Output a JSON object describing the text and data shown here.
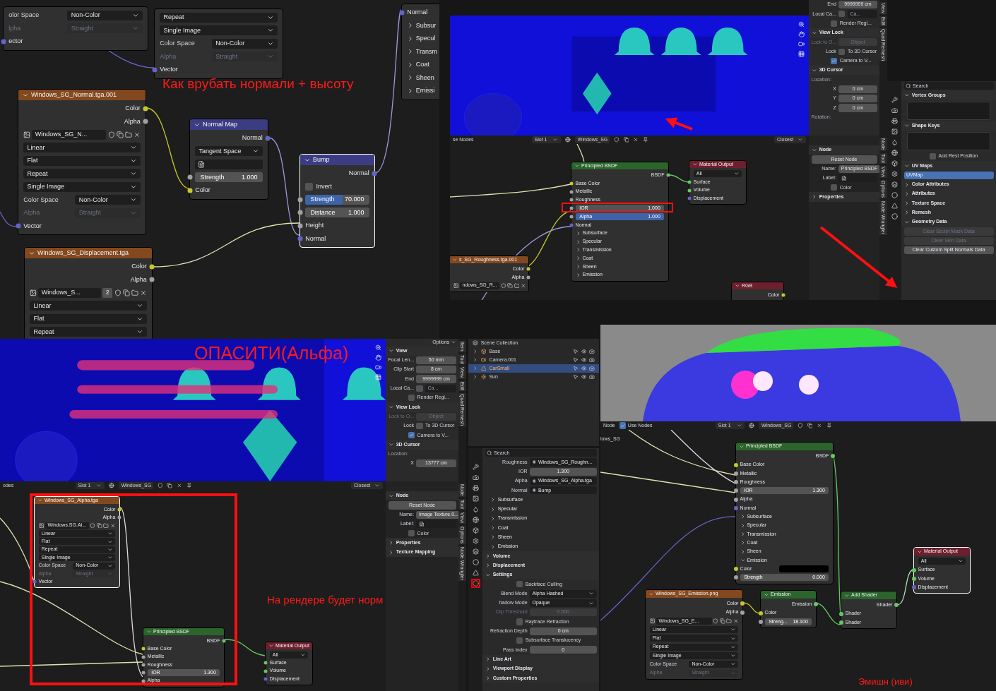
{
  "top_left": {
    "annotation": "Как врубать нормали + высоту",
    "nodes": [
      {
        "selected": false,
        "rows": [
          {
            "kind": "dropdown",
            "label": "olor Space",
            "value": "Non-Color",
            "disabled": false
          },
          {
            "kind": "dropdown",
            "label": "lpha",
            "value": "Straight",
            "disabled": true
          },
          {
            "kind": "input",
            "label": "ector",
            "color": "#6363c7"
          }
        ]
      },
      {
        "selected": false,
        "rows": [
          {
            "kind": "dropdown",
            "value": "Repeat",
            "disabled": false
          },
          {
            "kind": "dropdown",
            "value": "Single Image",
            "disabled": false
          },
          {
            "kind": "dropdown",
            "label": "Color Space",
            "value": "Non-Color",
            "disabled": false
          },
          {
            "kind": "dropdown",
            "label": "Alpha",
            "value": "Straight",
            "disabled": true
          },
          {
            "kind": "input",
            "label": "Vector",
            "color": "#6363c7"
          }
        ]
      },
      {
        "kind": "texture",
        "title": "Windows_SG_Normal.tga.001",
        "selected": false,
        "rows": [
          {
            "kind": "output",
            "label": "Color",
            "color": "#c7c729"
          },
          {
            "kind": "output",
            "label": "Alpha",
            "color": "#a1a1a1"
          },
          {
            "kind": "image",
            "value": "Windows_SG_N..."
          },
          {
            "kind": "dropdown",
            "value": "Linear",
            "disabled": false
          },
          {
            "kind": "dropdown",
            "value": "Flat",
            "disabled": false
          },
          {
            "kind": "dropdown",
            "value": "Repeat",
            "disabled": false
          },
          {
            "kind": "dropdown",
            "value": "Single Image",
            "disabled": false
          },
          {
            "kind": "dropdown",
            "label": "Color Space",
            "value": "Non-Color",
            "disabled": false
          },
          {
            "kind": "dropdown",
            "label": "Alpha",
            "value": "Straight",
            "disabled": true
          },
          {
            "kind": "input",
            "label": "Vector",
            "color": "#6363c7"
          }
        ]
      },
      {
        "kind": "vector",
        "title": "Normal Map",
        "selected": false,
        "rows": [
          {
            "kind": "output",
            "label": "Normal",
            "color": "#6363c7"
          },
          {
            "kind": "dropdown",
            "value": "Tangent Space",
            "disabled": false
          },
          {
            "kind": "uv"
          },
          {
            "kind": "field",
            "label": "Strength",
            "value": "1.000",
            "color": "#a1a1a1"
          },
          {
            "kind": "input",
            "label": "Color",
            "color": "#c7c729"
          }
        ]
      },
      {
        "kind": "vector",
        "title": "Bump",
        "selected": true,
        "rows": [
          {
            "kind": "output",
            "label": "Normal",
            "color": "#6363c7"
          },
          {
            "kind": "check",
            "label": "Invert",
            "checked": false
          },
          {
            "kind": "field",
            "label": "Strength",
            "value": "70.000",
            "level": 0.58,
            "color": "#a1a1a1"
          },
          {
            "kind": "field",
            "label": "Distance",
            "value": "1.000",
            "color": "#a1a1a1"
          },
          {
            "kind": "input",
            "label": "Height",
            "color": "#a1a1a1"
          },
          {
            "kind": "input",
            "label": "Normal",
            "color": "#6363c7"
          }
        ]
      },
      {
        "kind": "texture",
        "title": "Windows_SG_Displacement.tga",
        "selected": false,
        "rows": [
          {
            "kind": "output",
            "label": "Color",
            "color": "#c7c729"
          },
          {
            "kind": "output",
            "label": "Alpha",
            "color": "#a1a1a1"
          },
          {
            "kind": "image",
            "value": "Windows_S...",
            "users": "2"
          },
          {
            "kind": "dropdown",
            "value": "Linear",
            "disabled": false
          },
          {
            "kind": "dropdown",
            "value": "Flat",
            "disabled": false
          },
          {
            "kind": "dropdown",
            "value": "Repeat",
            "disabled": false
          }
        ]
      },
      {
        "selected": false,
        "rows": [
          {
            "kind": "input",
            "label": "Normal",
            "color": "#6363c7"
          },
          {
            "kind": "expander",
            "label": "Subsur",
            "expanded": false
          },
          {
            "kind": "expander",
            "label": "Specul",
            "expanded": false
          },
          {
            "kind": "expander",
            "label": "Transm",
            "expanded": false
          },
          {
            "kind": "expander",
            "label": "Coat",
            "expanded": false
          },
          {
            "kind": "expander",
            "label": "Sheen",
            "expanded": false
          },
          {
            "kind": "expander",
            "label": "Emissi",
            "expanded": false
          }
        ]
      }
    ]
  },
  "top_right": {
    "sidebar": {
      "tabs": [
        "View",
        "Edit",
        "Quad Remesh"
      ],
      "rows": [
        {
          "kind": "prop",
          "label": "End",
          "value": "9999999 cm"
        },
        {
          "kind": "check",
          "label": "Local Ca...",
          "checked": false,
          "value": "Ca..."
        },
        {
          "kind": "check",
          "checked": false,
          "text": "Render Regi..."
        },
        {
          "kind": "header",
          "label": "View Lock",
          "expanded": true
        },
        {
          "kind": "greyed_prop",
          "label": "Lock to O...",
          "value": "Object"
        },
        {
          "kind": "check",
          "label": "Lock",
          "checked": false,
          "text": "To 3D Cursor"
        },
        {
          "kind": "check",
          "checked": true,
          "text": "Camera to V..."
        },
        {
          "kind": "header",
          "label": "3D Cursor",
          "expanded": true
        },
        {
          "kind": "text",
          "label": "Location:"
        },
        {
          "kind": "prop",
          "label": "X",
          "value": "0 cm"
        },
        {
          "kind": "prop",
          "label": "Y",
          "value": "0 cm"
        },
        {
          "kind": "prop",
          "label": "Z",
          "value": "0 cm"
        },
        {
          "kind": "text",
          "label": "Rotation:"
        }
      ]
    },
    "node_header": {
      "editor": "se Nodes",
      "slot": "Slot 1",
      "material": "Windows_SG",
      "interp": "Closest"
    },
    "nodes": [
      {
        "kind": "shader",
        "title": "Principled BSDF",
        "selected": false,
        "rows": [
          {
            "kind": "output",
            "label": "BSDF",
            "color": "#63c763"
          },
          {
            "kind": "input",
            "label": "Base Color",
            "color": "#c7c729"
          },
          {
            "kind": "input",
            "label": "Metallic",
            "color": "#a1a1a1"
          },
          {
            "kind": "input",
            "label": "Roughness",
            "color": "#a1a1a1"
          },
          {
            "kind": "field",
            "label": "IOR",
            "value": "1.000",
            "color": "#a1a1a1"
          },
          {
            "kind": "field",
            "label": "Alpha",
            "value": "1.000",
            "level": 1,
            "color": "#a1a1a1"
          },
          {
            "kind": "input",
            "label": "Normal",
            "color": "#6363c7"
          },
          {
            "kind": "expander",
            "label": "Subsurface",
            "expanded": false
          },
          {
            "kind": "expander",
            "label": "Specular",
            "expanded": false
          },
          {
            "kind": "expander",
            "label": "Transmission",
            "expanded": false
          },
          {
            "kind": "expander",
            "label": "Coat",
            "expanded": false
          },
          {
            "kind": "expander",
            "label": "Sheen",
            "expanded": false
          },
          {
            "kind": "expander",
            "label": "Emission",
            "expanded": false
          }
        ]
      },
      {
        "kind": "output",
        "title": "Material Output",
        "selected": false,
        "rows": [
          {
            "kind": "dropdown",
            "value": "All",
            "disabled": false
          },
          {
            "kind": "input",
            "label": "Surface",
            "color": "#63c763"
          },
          {
            "kind": "input",
            "label": "Volume",
            "color": "#63c763"
          },
          {
            "kind": "input",
            "label": "Displacement",
            "color": "#6363c7"
          }
        ]
      },
      {
        "kind": "texture",
        "title": "s_SG_Roughness.tga.001",
        "selected": false,
        "rows": [
          {
            "kind": "output",
            "label": "Color",
            "color": "#c7c729"
          },
          {
            "kind": "output",
            "label": "Alpha",
            "color": "#a1a1a1"
          },
          {
            "kind": "image",
            "value": "ndows_SG_R..."
          }
        ]
      },
      {
        "kind": "output",
        "title": "RGB",
        "selected": false,
        "rows": [
          {
            "kind": "output",
            "label": "Color",
            "color": "#c7c729"
          }
        ]
      }
    ],
    "node_sidebar": {
      "tabs": [
        "Node",
        "Tool",
        "View",
        "Options",
        "Node Wrangler"
      ],
      "rows": [
        {
          "kind": "header",
          "label": "Node",
          "expanded": true
        },
        {
          "kind": "button",
          "label": "Reset Node"
        },
        {
          "kind": "prop",
          "label": "Name:",
          "value": "Principled BSDF"
        },
        {
          "kind": "prop",
          "label": "Label:"
        },
        {
          "kind": "check",
          "checked": false,
          "text": "Color"
        },
        {
          "kind": "header",
          "label": "Properties",
          "expanded": false
        }
      ]
    },
    "properties": {
      "rows": [
        {
          "kind": "search",
          "placeholder": "Search"
        },
        {
          "kind": "header",
          "label": "Vertex Groups",
          "expanded": true
        },
        {
          "kind": "listbox"
        },
        {
          "kind": "header",
          "label": "Shape Keys",
          "expanded": true
        },
        {
          "kind": "listbox"
        },
        {
          "kind": "check",
          "checked": false,
          "text": "Add Rest Position"
        },
        {
          "kind": "header",
          "label": "UV Maps",
          "expanded": true
        },
        {
          "kind": "listitem",
          "label": "UVMap",
          "selected": true
        },
        {
          "kind": "header",
          "label": "Color Attributes",
          "expanded": false
        },
        {
          "kind": "header",
          "label": "Attributes",
          "expanded": false
        },
        {
          "kind": "header",
          "label": "Texture Space",
          "expanded": false
        },
        {
          "kind": "header",
          "label": "Remesh",
          "expanded": false
        },
        {
          "kind": "header",
          "label": "Geometry Data",
          "expanded": true
        },
        {
          "kind": "greyed_button",
          "label": "Clear Sculpt Mask Data"
        },
        {
          "kind": "greyed_button",
          "label": "Clear Skin Data"
        },
        {
          "kind": "button",
          "label": "Clear Custom Split Normals Data"
        }
      ]
    }
  },
  "bottom_left": {
    "annotation": "ОПАСИТИ(Альфа)",
    "sidebar": {
      "options": "Options",
      "tabs": [
        "Item",
        "Tool",
        "View",
        "Edit",
        "Quad Remesh"
      ],
      "rows": [
        {
          "kind": "header",
          "label": "View",
          "expanded": true
        },
        {
          "kind": "prop",
          "label": "Focal Len...",
          "value": "50 mm"
        },
        {
          "kind": "prop",
          "label": "Clip Start",
          "value": "8 cm"
        },
        {
          "kind": "prop",
          "label": "End",
          "value": "9999999 cm"
        },
        {
          "kind": "check",
          "label": "Local Ca...",
          "checked": false,
          "value": "Ca..."
        },
        {
          "kind": "check",
          "checked": false,
          "text": "Render Regi..."
        },
        {
          "kind": "header",
          "label": "View Lock",
          "expanded": true
        },
        {
          "kind": "greyed_prop",
          "label": "Lock to O...",
          "value": "Object"
        },
        {
          "kind": "check",
          "label": "Lock",
          "checked": false,
          "text": "To 3D Cursor"
        },
        {
          "kind": "check",
          "checked": true,
          "text": "Camera to V..."
        },
        {
          "kind": "header",
          "label": "3D Cursor",
          "expanded": true
        },
        {
          "kind": "text",
          "label": "Location:"
        },
        {
          "kind": "prop",
          "label": "X",
          "value": "13777 cm"
        }
      ]
    },
    "node_header": {
      "editor": "odes",
      "slot": "Slot 1",
      "material": "Windows_SG",
      "interp": "Closest"
    },
    "nodes": [
      {
        "kind": "texture",
        "title": "Windows_SG_Alpha.tga",
        "selected": true,
        "rows": [
          {
            "kind": "output",
            "label": "Color",
            "color": "#c7c729"
          },
          {
            "kind": "output",
            "label": "Alpha",
            "color": "#a1a1a1"
          },
          {
            "kind": "image",
            "value": "Windows.SG.Al..."
          },
          {
            "kind": "dropdown",
            "value": "Linear",
            "disabled": false
          },
          {
            "kind": "dropdown",
            "value": "Flat",
            "disabled": false
          },
          {
            "kind": "dropdown",
            "value": "Repeat",
            "disabled": false
          },
          {
            "kind": "dropdown",
            "value": "Single Image",
            "disabled": false
          },
          {
            "kind": "dropdown",
            "label": "Color Space",
            "value": "Non-Color",
            "disabled": false
          },
          {
            "kind": "dropdown",
            "label": "Alpha",
            "value": "Straight",
            "disabled": true
          },
          {
            "kind": "input",
            "label": "Vector",
            "color": "#6363c7"
          }
        ]
      },
      {
        "kind": "shader",
        "title": "Principled BSDF",
        "selected": false,
        "rows": [
          {
            "kind": "output",
            "label": "BSDF",
            "color": "#63c763"
          },
          {
            "kind": "input",
            "label": "Base Color",
            "color": "#c7c729"
          },
          {
            "kind": "input",
            "label": "Metallic",
            "color": "#a1a1a1"
          },
          {
            "kind": "input",
            "label": "Roughness",
            "color": "#a1a1a1"
          },
          {
            "kind": "field",
            "label": "IOR",
            "value": "1.300",
            "color": "#a1a1a1"
          },
          {
            "kind": "input",
            "label": "Alpha",
            "color": "#a1a1a1"
          }
        ]
      },
      {
        "kind": "output",
        "title": "Material Output",
        "selected": false,
        "rows": [
          {
            "kind": "dropdown",
            "value": "All",
            "disabled": false
          },
          {
            "kind": "input",
            "label": "Surface",
            "color": "#63c763"
          },
          {
            "kind": "input",
            "label": "Volume",
            "color": "#63c763"
          },
          {
            "kind": "input",
            "label": "Displacement",
            "color": "#6363c7"
          }
        ]
      }
    ],
    "node_annotation": "На рендере будет норм",
    "node_sidebar": {
      "tabs": [
        "Node",
        "Tool",
        "View",
        "Options",
        "Node Wrangler"
      ],
      "rows": [
        {
          "kind": "header",
          "label": "Node",
          "expanded": true
        },
        {
          "kind": "button",
          "label": "Reset Node"
        },
        {
          "kind": "prop",
          "label": "Name:",
          "value": "Image Texture.0..."
        },
        {
          "kind": "prop",
          "label": "Label:"
        },
        {
          "kind": "check",
          "checked": false,
          "text": "Color"
        },
        {
          "kind": "header",
          "label": "Properties",
          "expanded": false
        },
        {
          "kind": "header",
          "label": "Texture Mapping",
          "expanded": false
        }
      ]
    }
  },
  "outliner": {
    "title": "Scene Collection",
    "items": [
      {
        "kind": "collection",
        "label": "Base",
        "selected": false
      },
      {
        "kind": "camera",
        "label": "Camera.001",
        "selected": false
      },
      {
        "kind": "mesh",
        "label": "CarSmall",
        "selected": true
      },
      {
        "kind": "light",
        "label": "Sun",
        "selected": false
      }
    ]
  },
  "material_properties": {
    "rows": [
      {
        "kind": "search",
        "placeholder": "Search"
      },
      {
        "kind": "link",
        "label": "Roughness",
        "value": "Windows_SG_Roughn..."
      },
      {
        "kind": "prop",
        "label": "IOR",
        "value": "1.300"
      },
      {
        "kind": "link",
        "label": "Alpha",
        "value": "Windows_SG_Alpha.tga"
      },
      {
        "kind": "link",
        "label": "Normal",
        "value": "Bump"
      },
      {
        "kind": "expander",
        "label": "Subsurface",
        "expanded": false
      },
      {
        "kind": "expander",
        "label": "Specular",
        "expanded": false
      },
      {
        "kind": "expander",
        "label": "Transmission",
        "expanded": false
      },
      {
        "kind": "expander",
        "label": "Coat",
        "expanded": false
      },
      {
        "kind": "expander",
        "label": "Sheen",
        "expanded": false
      },
      {
        "kind": "expander",
        "label": "Emission",
        "expanded": false
      },
      {
        "kind": "header",
        "label": "Volume",
        "expanded": false
      },
      {
        "kind": "header",
        "label": "Displacement",
        "expanded": false
      },
      {
        "kind": "header",
        "label": "Settings",
        "expanded": true
      },
      {
        "kind": "check",
        "checked": false,
        "text": "Backface Culling"
      },
      {
        "kind": "select",
        "label": "Blend Mode",
        "value": "Alpha Hashed"
      },
      {
        "kind": "select",
        "label": "hadow Mode",
        "value": "Opaque"
      },
      {
        "kind": "greyed_prop",
        "label": "Clip Threshold",
        "value": "0.500"
      },
      {
        "kind": "check",
        "checked": false,
        "text": "Raytrace Refraction"
      },
      {
        "kind": "prop",
        "label": "Refraction Depth",
        "value": "0 cm"
      },
      {
        "kind": "check",
        "checked": false,
        "text": "Subsurface Translucency"
      },
      {
        "kind": "prop",
        "label": "Pass Index",
        "value": "0"
      },
      {
        "kind": "header",
        "label": "Line Art",
        "expanded": false
      },
      {
        "kind": "header",
        "label": "Viewport Display",
        "expanded": false
      },
      {
        "kind": "header",
        "label": "Custom Properties",
        "expanded": false
      }
    ]
  },
  "bottom_right": {
    "node_header": {
      "editor": "Node",
      "use_nodes": {
        "label": "Use Nodes",
        "checked": true
      },
      "slot": "Slot 1",
      "material": "Windows_SG"
    },
    "material_label": "lows_SG",
    "annotation": "Эмишн (иви)",
    "nodes": [
      {
        "kind": "shader",
        "title": "Principled BSDF",
        "selected": false,
        "rows": [
          {
            "kind": "output",
            "label": "BSDF",
            "color": "#63c763"
          },
          {
            "kind": "input",
            "label": "Base Color",
            "color": "#c7c729"
          },
          {
            "kind": "input",
            "label": "Metallic",
            "color": "#a1a1a1"
          },
          {
            "kind": "input",
            "label": "Roughness",
            "color": "#a1a1a1"
          },
          {
            "kind": "field",
            "label": "IOR",
            "value": "1.300",
            "color": "#a1a1a1"
          },
          {
            "kind": "input",
            "label": "Alpha",
            "color": "#a1a1a1"
          },
          {
            "kind": "input",
            "label": "Normal",
            "color": "#6363c7"
          },
          {
            "kind": "expander",
            "label": "Subsurface",
            "expanded": false
          },
          {
            "kind": "expander",
            "label": "Specular",
            "expanded": false
          },
          {
            "kind": "expander",
            "label": "Transmission",
            "expanded": false
          },
          {
            "kind": "expander",
            "label": "Coat",
            "expanded": false
          },
          {
            "kind": "expander",
            "label": "Sheen",
            "expanded": false
          },
          {
            "kind": "expander",
            "label": "Emission",
            "expanded": true
          },
          {
            "kind": "swatch",
            "label": "Color",
            "color": "#000000",
            "socket": {
              "color": "#c7c729"
            }
          },
          {
            "kind": "field",
            "label": "Strength",
            "value": "0.000",
            "color": "#a1a1a1"
          }
        ]
      },
      {
        "kind": "texture",
        "title": "Windows_SG_Emission.png",
        "selected": false,
        "rows": [
          {
            "kind": "output",
            "label": "Color",
            "color": "#c7c729"
          },
          {
            "kind": "output",
            "label": "Alpha",
            "color": "#a1a1a1"
          },
          {
            "kind": "image",
            "value": "Windows_SG_E..."
          },
          {
            "kind": "dropdown",
            "value": "Linear",
            "disabled": false
          },
          {
            "kind": "dropdown",
            "value": "Flat",
            "disabled": false
          },
          {
            "kind": "dropdown",
            "value": "Repeat",
            "disabled": false
          },
          {
            "kind": "dropdown",
            "value": "Single Image",
            "disabled": false
          },
          {
            "kind": "dropdown",
            "label": "Color Space",
            "value": "Non-Color",
            "disabled": false
          },
          {
            "kind": "dropdown",
            "label": "Alpha",
            "value": "Straight",
            "disabled": true
          }
        ]
      },
      {
        "kind": "shader",
        "title": "Emission",
        "selected": false,
        "rows": [
          {
            "kind": "output",
            "label": "Emission",
            "color": "#63c763"
          },
          {
            "kind": "input",
            "label": "Color",
            "color": "#c7c729"
          },
          {
            "kind": "field",
            "label": "Streng...",
            "value": "18.100",
            "color": "#a1a1a1"
          }
        ]
      },
      {
        "kind": "shader",
        "title": "Add Shader",
        "selected": false,
        "rows": [
          {
            "kind": "output",
            "label": "Shader",
            "color": "#63c763"
          },
          {
            "kind": "input",
            "label": "Shader",
            "color": "#63c763"
          },
          {
            "kind": "input",
            "label": "Shader",
            "color": "#63c763"
          }
        ]
      },
      {
        "kind": "output",
        "title": "Material Output",
        "selected": true,
        "rows": [
          {
            "kind": "dropdown",
            "value": "All",
            "disabled": false
          },
          {
            "kind": "input",
            "label": "Surface",
            "color": "#63c763"
          },
          {
            "kind": "input",
            "label": "Volume",
            "color": "#63c763"
          },
          {
            "kind": "input",
            "label": "Displacement",
            "color": "#6363c7"
          }
        ]
      }
    ]
  }
}
